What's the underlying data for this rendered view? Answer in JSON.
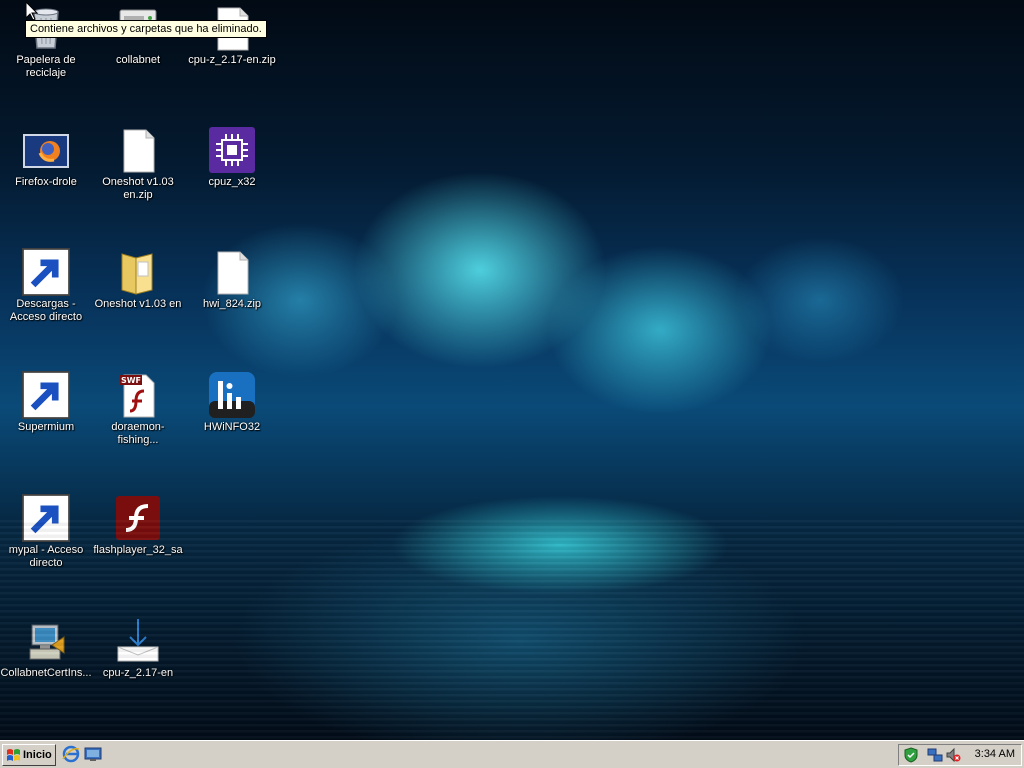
{
  "tooltip": "Contiene archivos y carpetas que ha eliminado.",
  "desktop_icons": [
    {
      "label": "Papelera de reciclaje",
      "icon": "recycle-bin-icon"
    },
    {
      "label": "collabnet",
      "icon": "drive-icon"
    },
    {
      "label": "cpu-z_2.17-en.zip",
      "icon": "zip-file-icon"
    },
    {
      "label": "Firefox-drole",
      "icon": "firefox-image-icon"
    },
    {
      "label": "Oneshot v1.03 en.zip",
      "icon": "zip-file-icon"
    },
    {
      "label": "cpuz_x32",
      "icon": "cpuz-icon"
    },
    {
      "label": "Descargas - Acceso directo",
      "icon": "downloads-folder-icon"
    },
    {
      "label": "Oneshot v1.03 en",
      "icon": "folder-icon"
    },
    {
      "label": "hwi_824.zip",
      "icon": "zip-file-icon"
    },
    {
      "label": "Supermium",
      "icon": "supermium-browser-icon"
    },
    {
      "label": "doraemon-fishing...",
      "icon": "swf-file-icon"
    },
    {
      "label": "HWiNFO32",
      "icon": "hwinfo-icon"
    },
    {
      "label": "mypal - Acceso directo",
      "icon": "mypal-raccoon-icon"
    },
    {
      "label": "flashplayer_32_sa",
      "icon": "flash-player-icon"
    },
    {
      "label": "CollabnetCertIns...",
      "icon": "installer-icon"
    },
    {
      "label": "cpu-z_2.17-en",
      "icon": "download-folder-icon"
    }
  ],
  "taskbar": {
    "start_label": "Inicio",
    "quick_launch": [
      "internet-explorer-icon",
      "show-desktop-icon"
    ],
    "tray_icons": [
      "security-shield-icon",
      "network-icon",
      "volume-muted-icon"
    ],
    "clock": "3:34 AM"
  },
  "colors": {
    "taskbar": "#d4d0c8",
    "tooltip_bg": "#ffffe1",
    "desktop_glow": "#3ce6f0"
  }
}
